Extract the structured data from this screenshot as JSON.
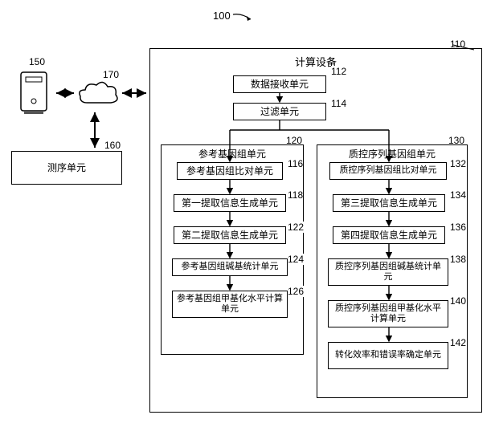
{
  "figure_ref": "100",
  "server_ref": "150",
  "cloud_ref": "170",
  "seq_unit_ref": "160",
  "seq_unit_label": "测序单元",
  "device_ref": "110",
  "device_title": "计算设备",
  "recv_ref": "112",
  "recv_label": "数据接收单元",
  "filter_ref": "114",
  "filter_label": "过滤单元",
  "left_group_ref": "120",
  "left_group_title": "参考基因组单元",
  "l116_ref": "116",
  "l116_label": "参考基因组比对单元",
  "l118_ref": "118",
  "l118_label": "第一提取信息生成单元",
  "l122_ref": "122",
  "l122_label": "第二提取信息生成单元",
  "l124_ref": "124",
  "l124_label": "参考基因组碱基统计单元",
  "l126_ref": "126",
  "l126_label": "参考基因组甲基化水平计算单元",
  "right_group_ref": "130",
  "right_group_title": "质控序列基因组单元",
  "r132_ref": "132",
  "r132_label": "质控序列基因组比对单元",
  "r134_ref": "134",
  "r134_label": "第三提取信息生成单元",
  "r136_ref": "136",
  "r136_label": "第四提取信息生成单元",
  "r138_ref": "138",
  "r138_label": "质控序列基因组碱基统计单元",
  "r140_ref": "140",
  "r140_label": "质控序列基因组甲基化水平计算单元",
  "r142_ref": "142",
  "r142_label": "转化效率和错误率确定单元"
}
